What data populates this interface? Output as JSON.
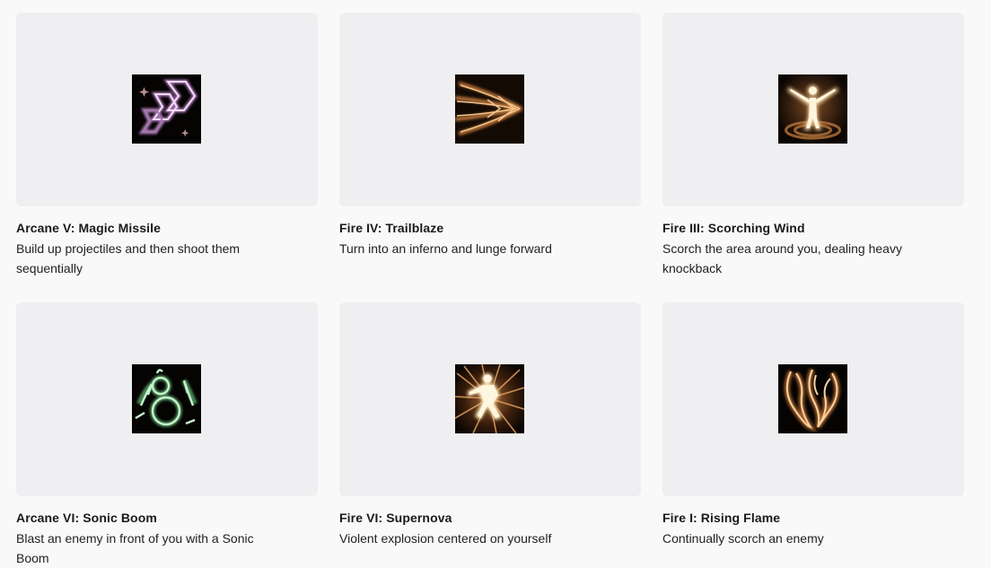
{
  "abilities": [
    {
      "title": "Arcane V: Magic Missile",
      "description": "Build up projectiles and then shoot them sequentially",
      "icon": "magic-missile-icon"
    },
    {
      "title": "Fire IV: Trailblaze",
      "description": "Turn into an inferno and lunge forward",
      "icon": "trailblaze-icon"
    },
    {
      "title": "Fire III: Scorching Wind",
      "description": "Scorch the area around you, dealing heavy knockback",
      "icon": "scorching-wind-icon"
    },
    {
      "title": "Arcane VI: Sonic Boom",
      "description": "Blast an enemy in front of you with a Sonic Boom",
      "icon": "sonic-boom-icon"
    },
    {
      "title": "Fire VI: Supernova",
      "description": "Violent explosion centered on yourself",
      "icon": "supernova-icon"
    },
    {
      "title": "Fire I: Rising Flame",
      "description": "Continually scorch an enemy",
      "icon": "rising-flame-icon"
    }
  ],
  "colors": {
    "arcane_pink": "#e6b4f2",
    "arcane_green": "#9ed9a8",
    "fire_orange": "#e8a060",
    "fire_glow": "#fff0c8"
  }
}
